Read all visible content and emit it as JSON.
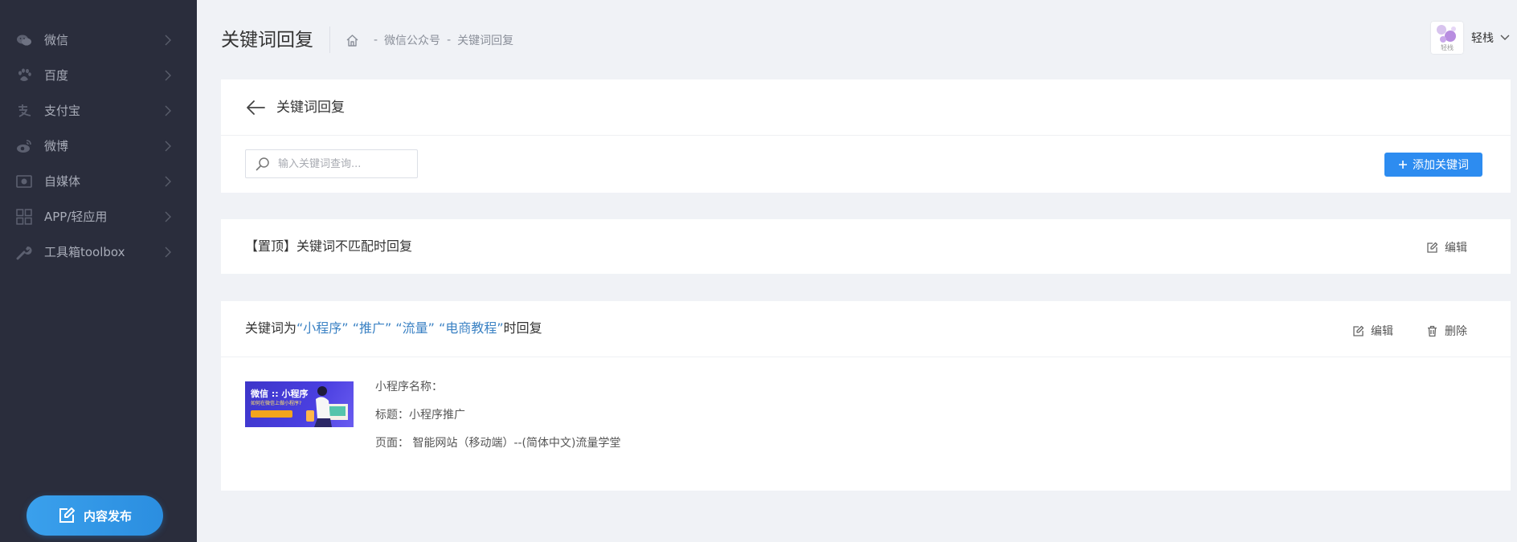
{
  "sidebar": {
    "items": [
      {
        "label": "微信"
      },
      {
        "label": "百度"
      },
      {
        "label": "支付宝"
      },
      {
        "label": "微博"
      },
      {
        "label": "自媒体"
      },
      {
        "label": "APP/轻应用"
      },
      {
        "label": "工具箱toolbox"
      }
    ],
    "publish_label": "内容发布"
  },
  "header": {
    "title": "关键词回复",
    "breadcrumb": [
      "微信公众号",
      "关键词回复"
    ],
    "breadcrumb_sep": "-",
    "user_name": "轻栈",
    "avatar_text": "轻栈"
  },
  "panel": {
    "title": "关键词回复",
    "search_placeholder": "输入关键词查询...",
    "add_label": "添加关键词"
  },
  "default_rule": {
    "title": "【置顶】关键词不匹配时回复",
    "edit_label": "编辑"
  },
  "keyword_rule": {
    "prefix": "关键词为",
    "keywords": [
      "“小程序”",
      "“推广”",
      "“流量”",
      "“电商教程”"
    ],
    "suffix": "时回复",
    "edit_label": "编辑",
    "delete_label": "删除",
    "thumbnail": {
      "line1": "微信 :: 小程序",
      "line2": "如何在微信上做小程序?"
    },
    "name_label": "小程序名称：",
    "title_label": "标题：",
    "title_value": "小程序推广",
    "page_label": "页面：",
    "page_value": "智能网站（移动端）--(简体中文)流量学堂"
  },
  "colors": {
    "sidebar_bg": "#2a2d3c",
    "accent": "#2d8cf0",
    "keyword": "#3b82c4"
  }
}
